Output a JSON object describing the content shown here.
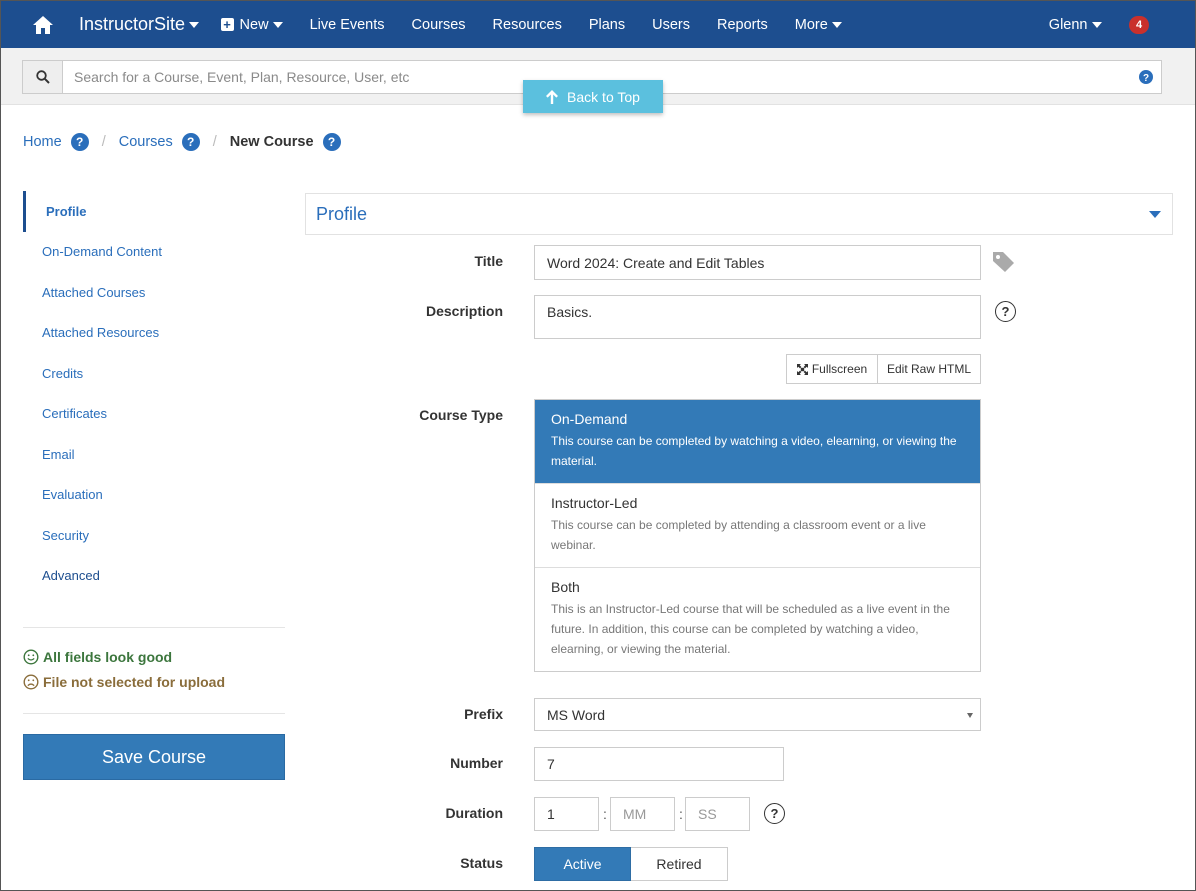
{
  "nav": {
    "brand": "InstructorSite",
    "new_label": "New",
    "items": [
      "Live Events",
      "Courses",
      "Resources",
      "Plans",
      "Users",
      "Reports"
    ],
    "more_label": "More",
    "user_label": "Glenn",
    "notification_count": "4"
  },
  "search": {
    "placeholder": "Search for a Course, Event, Plan, Resource, User, etc"
  },
  "back_to_top": "Back to Top",
  "breadcrumb": {
    "home": "Home",
    "courses": "Courses",
    "current": "New Course"
  },
  "sidebar": {
    "items": [
      "Profile",
      "On-Demand Content",
      "Attached Courses",
      "Attached Resources",
      "Credits",
      "Certificates",
      "Email",
      "Evaluation",
      "Security",
      "Advanced"
    ],
    "status_good": "All fields look good",
    "status_warn": "File not selected for upload",
    "save_label": "Save Course"
  },
  "panel": {
    "title": "Profile"
  },
  "form": {
    "title_label": "Title",
    "title_value": "Word 2024: Create and Edit Tables",
    "description_label": "Description",
    "description_value": "Basics.",
    "fullscreen_label": "Fullscreen",
    "edit_raw_label": "Edit Raw HTML",
    "course_type_label": "Course Type",
    "course_types": [
      {
        "title": "On-Demand",
        "desc": "This course can be completed by watching a video, elearning, or viewing the material."
      },
      {
        "title": "Instructor-Led",
        "desc": "This course can be completed by attending a classroom event or a live webinar."
      },
      {
        "title": "Both",
        "desc": "This is an Instructor-Led course that will be scheduled as a live event in the future. In addition, this course can be completed by watching a video, elearning, or viewing the material."
      }
    ],
    "selected_course_type": "On-Demand",
    "prefix_label": "Prefix",
    "prefix_value": "MS Word",
    "number_label": "Number",
    "number_value": "7",
    "duration_label": "Duration",
    "duration_hours": "1",
    "duration_minutes_placeholder": "MM",
    "duration_seconds_placeholder": "SS",
    "status_label": "Status",
    "status_active": "Active",
    "status_retired": "Retired",
    "status_selected": "Active"
  },
  "colors": {
    "navbar": "#1d4e8f",
    "primary": "#337ab7",
    "link": "#2a6ebb",
    "info": "#5bc0de",
    "success": "#3c763d",
    "warning": "#8a6d3b",
    "badge": "#c9302c"
  }
}
